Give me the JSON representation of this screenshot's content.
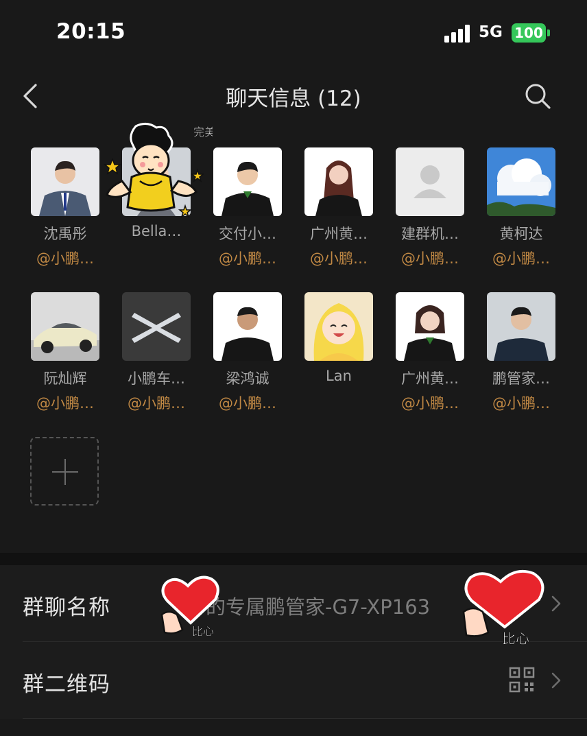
{
  "status_bar": {
    "time": "20:15",
    "network": "5G",
    "battery": "100"
  },
  "header": {
    "title": "聊天信息 (12)",
    "back_icon": "chevron-left-icon",
    "search_icon": "search-icon"
  },
  "members": [
    {
      "name": "沈禹彤",
      "role": "@小鹏…"
    },
    {
      "name": "Bella…",
      "role": ""
    },
    {
      "name": "交付小…",
      "role": "@小鹏…"
    },
    {
      "name": "广州黄…",
      "role": "@小鹏…"
    },
    {
      "name": "建群机…",
      "role": "@小鹏…"
    },
    {
      "name": "黄柯达",
      "role": "@小鹏…"
    },
    {
      "name": "阮灿辉",
      "role": "@小鹏…"
    },
    {
      "name": "小鹏车…",
      "role": "@小鹏…"
    },
    {
      "name": "梁鸿诚",
      "role": "@小鹏…"
    },
    {
      "name": "Lan",
      "role": ""
    },
    {
      "name": "广州黄…",
      "role": "@小鹏…"
    },
    {
      "name": "鹏管家…",
      "role": "@小鹏…"
    }
  ],
  "add_member_icon": "plus-icon",
  "settings": {
    "group_name_label": "群聊名称",
    "group_name_value": "的专属鹏管家-G7-XP163",
    "group_qr_label": "群二维码",
    "qr_icon": "qr-code-icon"
  },
  "stickers": {
    "cartoon_text": "完美",
    "heart_text": "比心"
  },
  "colors": {
    "background": "#191919",
    "role_accent": "#c08844",
    "battery": "#35c75a"
  }
}
